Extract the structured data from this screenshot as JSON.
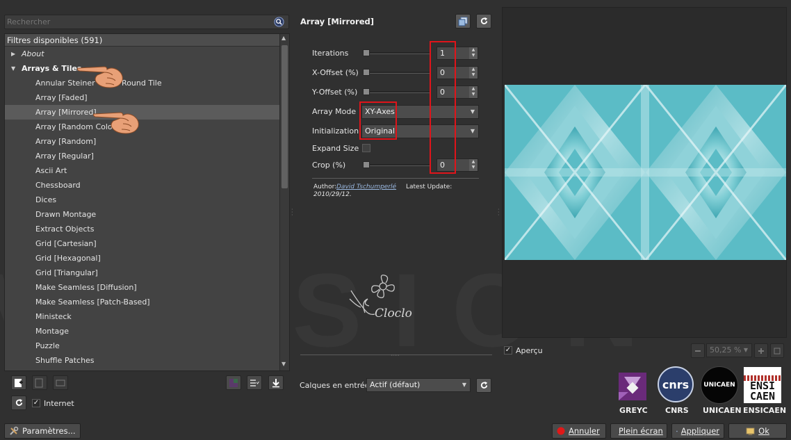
{
  "watermark": "VERSION",
  "search": {
    "placeholder": "Rechercher",
    "icon": "search-icon"
  },
  "filters": {
    "header": "Filtres disponibles (591)",
    "items": [
      {
        "label": "About",
        "kind": "folder-collapsed"
      },
      {
        "label": "Arrays & Tiles",
        "kind": "folder-expanded"
      },
      {
        "label": "Annular Steiner Chain Round Tile",
        "kind": "leaf"
      },
      {
        "label": "Array [Faded]",
        "kind": "leaf"
      },
      {
        "label": "Array [Mirrored]",
        "kind": "leaf",
        "selected": true
      },
      {
        "label": "Array [Random Colors]",
        "kind": "leaf"
      },
      {
        "label": "Array [Random]",
        "kind": "leaf"
      },
      {
        "label": "Array [Regular]",
        "kind": "leaf"
      },
      {
        "label": "Ascii Art",
        "kind": "leaf"
      },
      {
        "label": "Chessboard",
        "kind": "leaf"
      },
      {
        "label": "Dices",
        "kind": "leaf"
      },
      {
        "label": "Drawn Montage",
        "kind": "leaf"
      },
      {
        "label": "Extract Objects",
        "kind": "leaf"
      },
      {
        "label": "Grid [Cartesian]",
        "kind": "leaf"
      },
      {
        "label": "Grid [Hexagonal]",
        "kind": "leaf"
      },
      {
        "label": "Grid [Triangular]",
        "kind": "leaf"
      },
      {
        "label": "Make Seamless [Diffusion]",
        "kind": "leaf"
      },
      {
        "label": "Make Seamless [Patch-Based]",
        "kind": "leaf"
      },
      {
        "label": "Ministeck",
        "kind": "leaf"
      },
      {
        "label": "Montage",
        "kind": "leaf"
      },
      {
        "label": "Puzzle",
        "kind": "leaf"
      },
      {
        "label": "Shuffle Patches",
        "kind": "leaf"
      }
    ]
  },
  "internet": {
    "label": "Internet",
    "checked": true
  },
  "params_button": "Paramètres...",
  "filter_panel": {
    "title": "Array [Mirrored]",
    "iterations": {
      "label": "Iterations",
      "value": "1"
    },
    "x_offset": {
      "label": "X-Offset (%)",
      "value": "0"
    },
    "y_offset": {
      "label": "Y-Offset (%)",
      "value": "0"
    },
    "array_mode": {
      "label": "Array Mode",
      "value": "XY-Axes"
    },
    "initialization": {
      "label": "Initialization",
      "value": "Original"
    },
    "expand_size": {
      "label": "Expand Size",
      "checked": false
    },
    "crop": {
      "label": "Crop (%)",
      "value": "0"
    },
    "author_label": "Author:",
    "author_name": "David Tschumperlé",
    "author_date": "2010/29/12.",
    "latest_update": "Latest Update:"
  },
  "signature": "Cloclo",
  "layers": {
    "label": "Calques en entrée",
    "value": "Actif (défaut)"
  },
  "preview": {
    "apercu": {
      "label": "Aperçu",
      "checked": true
    },
    "zoom": "50,25 %"
  },
  "logos": [
    {
      "name": "GREYC"
    },
    {
      "name": "CNRS",
      "badge": "cnrs"
    },
    {
      "name": "UNICAEN",
      "badge": "UNICAEN"
    },
    {
      "name": "ENSICAEN",
      "badge": "ENSI CAEN"
    }
  ],
  "buttons": {
    "annuler": "Annuler",
    "plein_ecran": "Plein écran",
    "appliquer": "Appliquer",
    "ok": "Ok"
  },
  "colors": {
    "accent_red": "#e0141a",
    "preview_teal": "#5fbcc6"
  }
}
